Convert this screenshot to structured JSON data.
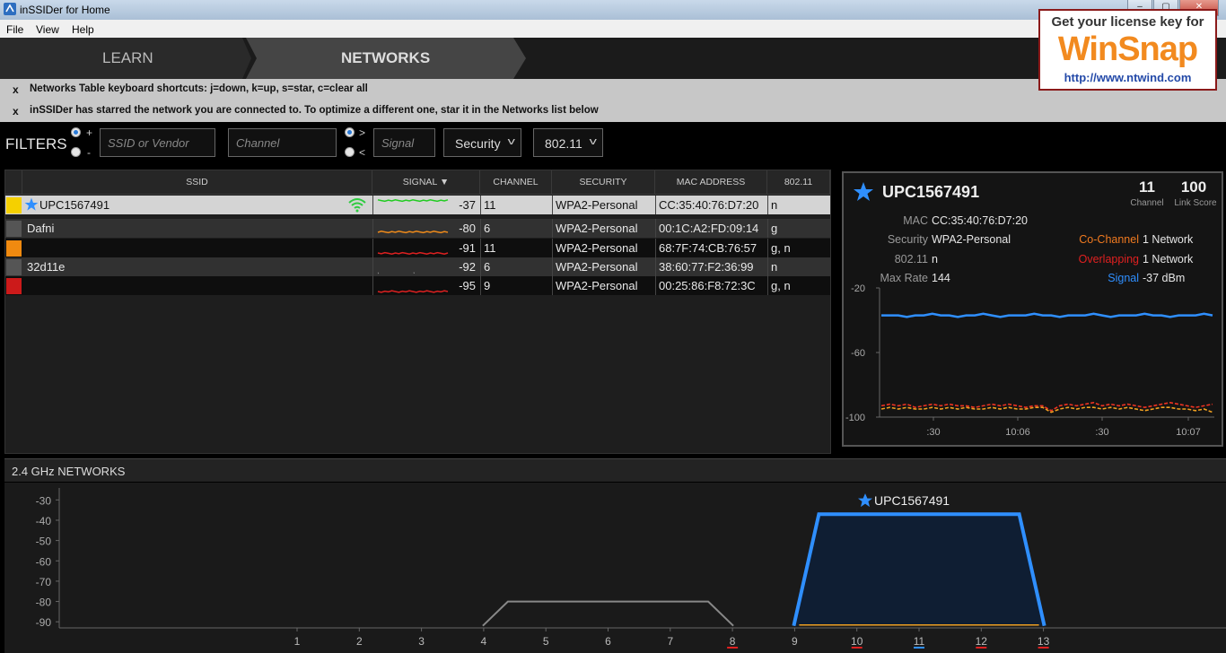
{
  "window": {
    "title": "inSSIDer for Home"
  },
  "menu": [
    "File",
    "View",
    "Help"
  ],
  "nav": {
    "learn": "LEARN",
    "networks": "NETWORKS"
  },
  "notices": [
    {
      "close": "x",
      "text": "Networks Table keyboard shortcuts: j=down, k=up, s=star, c=clear all"
    },
    {
      "close": "x",
      "text": "inSSIDer has starred the network you are connected to. To optimize a different one, star it in the Networks list below"
    }
  ],
  "watermark": {
    "line1": "Get your license key for",
    "line2": "WinSnap",
    "line3": "http://www.ntwind.com"
  },
  "filters": {
    "label": "FILTERS",
    "plus": "+",
    "minus": "-",
    "gt": ">",
    "lt": "<",
    "ssid_placeholder": "SSID or Vendor",
    "channel_placeholder": "Channel",
    "signal_placeholder": "Signal",
    "security": "Security",
    "standard": "802.11"
  },
  "table": {
    "headers": [
      "SSID",
      "SIGNAL",
      "CHANNEL",
      "SECURITY",
      "MAC ADDRESS",
      "802.11"
    ],
    "rows": [
      {
        "color": "#f5d000",
        "starred": true,
        "ssid": "UPC1567491",
        "signal": "-37",
        "channel": "11",
        "security": "WPA2-Personal",
        "mac": "CC:35:40:76:D7:20",
        "std": "n",
        "spark": "#22cc22",
        "spark_level": 0.95
      },
      {
        "color": "#555555",
        "starred": false,
        "ssid": "Dafni",
        "signal": "-80",
        "channel": "6",
        "security": "WPA2-Personal",
        "mac": "00:1C:A2:FD:09:14",
        "std": "g",
        "spark": "#ee8a1a",
        "spark_level": 0.2
      },
      {
        "color": "#f08a10",
        "starred": false,
        "ssid": "",
        "signal": "-91",
        "channel": "11",
        "security": "WPA2-Personal",
        "mac": "68:7F:74:CB:76:57",
        "std": "g, n",
        "spark": "#dd2020",
        "spark_level": 0.05
      },
      {
        "color": "#555555",
        "starred": false,
        "ssid": "32d11e",
        "signal": "-92",
        "channel": "6",
        "security": "WPA2-Personal",
        "mac": "38:60:77:F2:36:99",
        "std": "n",
        "spark": "#888888",
        "spark_level": 0.02
      },
      {
        "color": "#cc1a1a",
        "starred": false,
        "ssid": "",
        "signal": "-95",
        "channel": "9",
        "security": "WPA2-Personal",
        "mac": "00:25:86:F8:72:3C",
        "std": "g, n",
        "spark": "#dd2020",
        "spark_level": 0.0
      }
    ]
  },
  "detail": {
    "ssid": "UPC1567491",
    "channel": "11",
    "channel_label": "Channel",
    "link_score": "100",
    "link_score_label": "Link Score",
    "mac_label": "MAC",
    "mac": "CC:35:40:76:D7:20",
    "security_label": "Security",
    "security": "WPA2-Personal",
    "std_label": "802.11",
    "std": "n",
    "rate_label": "Max Rate",
    "rate": "144",
    "cochannel_label": "Co-Channel",
    "cochannel": "1 Network",
    "overlap_label": "Overlapping",
    "overlap": "1 Network",
    "signal_label": "Signal",
    "signal": "-37 dBm",
    "colors": {
      "cochannel": "#f07a20",
      "overlap": "#e02020",
      "signal": "#2f8fff"
    }
  },
  "chart_data": [
    {
      "type": "line",
      "yticks": [
        "-20",
        "-60",
        "-100"
      ],
      "ylim": [
        -100,
        -20
      ],
      "xticks": [
        ":30",
        "10:06",
        ":30",
        "10:07"
      ],
      "series": [
        {
          "color": "#2f8fff",
          "values": [
            -37,
            -37,
            -37,
            -38,
            -37,
            -37,
            -36,
            -37,
            -37,
            -38,
            -37,
            -37,
            -36,
            -37,
            -38,
            -37,
            -37,
            -37,
            -36,
            -37,
            -37,
            -38,
            -37,
            -37,
            -37,
            -36,
            -37,
            -38,
            -37,
            -37,
            -37,
            -36,
            -37,
            -37,
            -38,
            -37,
            -37,
            -37,
            -36,
            -37
          ]
        },
        {
          "color": "#ee3322",
          "values": [
            -93,
            -92,
            -93,
            -92,
            -94,
            -93,
            -92,
            -93,
            -92,
            -93,
            -93,
            -94,
            -93,
            -92,
            -93,
            -92,
            -93,
            -94,
            -93,
            -93,
            -96,
            -93,
            -92,
            -93,
            -92,
            -91,
            -93,
            -92,
            -93,
            -92,
            -93,
            -94,
            -93,
            -92,
            -91,
            -92,
            -93,
            -94,
            -93,
            -92
          ]
        },
        {
          "color": "#f0a020",
          "values": [
            -95,
            -94,
            -95,
            -94,
            -95,
            -95,
            -94,
            -95,
            -94,
            -95,
            -94,
            -95,
            -95,
            -94,
            -95,
            -94,
            -95,
            -95,
            -94,
            -94,
            -97,
            -95,
            -94,
            -95,
            -94,
            -94,
            -95,
            -94,
            -95,
            -94,
            -95,
            -96,
            -95,
            -94,
            -94,
            -95,
            -95,
            -96,
            -95,
            -97
          ]
        }
      ]
    },
    {
      "type": "area",
      "title": "2.4 GHz NETWORKS",
      "yticks": [
        "-30",
        "-40",
        "-50",
        "-60",
        "-70",
        "-80",
        "-90"
      ],
      "ylim": [
        -93,
        -25
      ],
      "channels": [
        "1",
        "2",
        "3",
        "4",
        "5",
        "6",
        "7",
        "8",
        "9",
        "10",
        "11",
        "12",
        "13"
      ],
      "networks": [
        {
          "name": "UPC1567491",
          "starred": true,
          "channel": 11,
          "signal": -37,
          "color": "#2f8fff"
        },
        {
          "name": "Dafni",
          "starred": false,
          "channel": 6,
          "signal": -80,
          "color": "#888888"
        }
      ]
    }
  ]
}
